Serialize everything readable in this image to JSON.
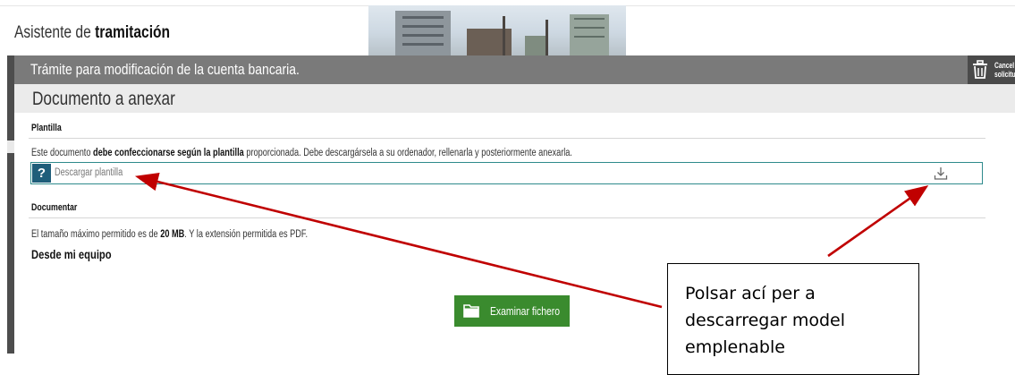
{
  "header": {
    "title_prefix": "Asistente de ",
    "title_bold": "tramitación"
  },
  "procedure": {
    "title": "Trámite para modificación de la cuenta bancaria.",
    "cancel_line1": "Cancel",
    "cancel_line2": "solicitu"
  },
  "section": {
    "title": "Documento a anexar"
  },
  "plantilla": {
    "heading": "Plantilla",
    "desc_pre": "Este documento ",
    "desc_bold": "debe confeccionarse según la plantilla",
    "desc_post": " proporcionada. Debe descargársela a su ordenador, rellenarla y posteriormente anexarla.",
    "help_glyph": "?",
    "download_label": "Descargar plantilla",
    "download_icon": "download-icon"
  },
  "documentar": {
    "heading": "Documentar",
    "size_pre": "El tamaño máximo permitido es de ",
    "size_bold": "20 MB",
    "size_post": ". Y la extensión permitida es PDF.",
    "source_label": "Desde mi equipo",
    "browse_label": "Examinar fichero",
    "browse_icon": "folder-icon"
  },
  "annotation": {
    "text": "Polsar ací per a descarregar model emplenable",
    "arrow_color": "#c00000"
  },
  "colors": {
    "proc_bar": "#7a7a7a",
    "browse_button": "#3a8b2e",
    "help_button": "#1f5e7a",
    "download_border": "#2e8a8c"
  }
}
